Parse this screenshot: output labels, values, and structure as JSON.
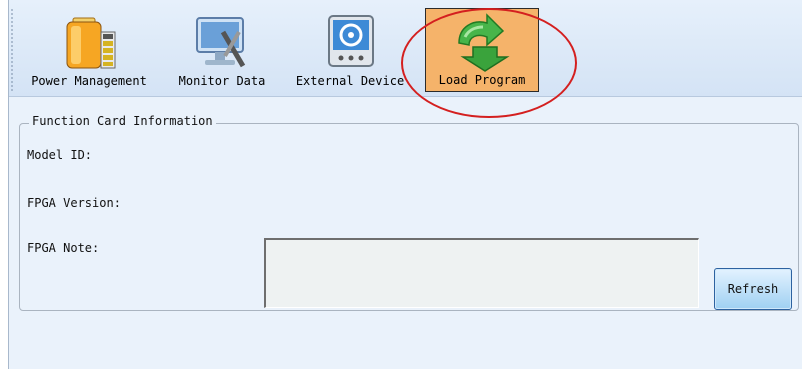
{
  "toolbar": {
    "items": [
      {
        "label": "Power Management",
        "icon": "battery-icon"
      },
      {
        "label": "Monitor Data",
        "icon": "monitor-icon"
      },
      {
        "label": "External Device",
        "icon": "external-device-icon"
      },
      {
        "label": "Load Program",
        "icon": "load-arrow-icon",
        "active": true
      }
    ]
  },
  "group": {
    "title": "Function Card Information",
    "model_id_label": "Model ID:",
    "fpga_version_label": "FPGA Version:",
    "fpga_note_label": "FPGA Note:",
    "refresh_label": "Refresh"
  },
  "colors": {
    "active_tool_bg": "#f5b36a",
    "highlight_ring": "#d41f1f",
    "panel_bg": "#eaf2fb"
  }
}
